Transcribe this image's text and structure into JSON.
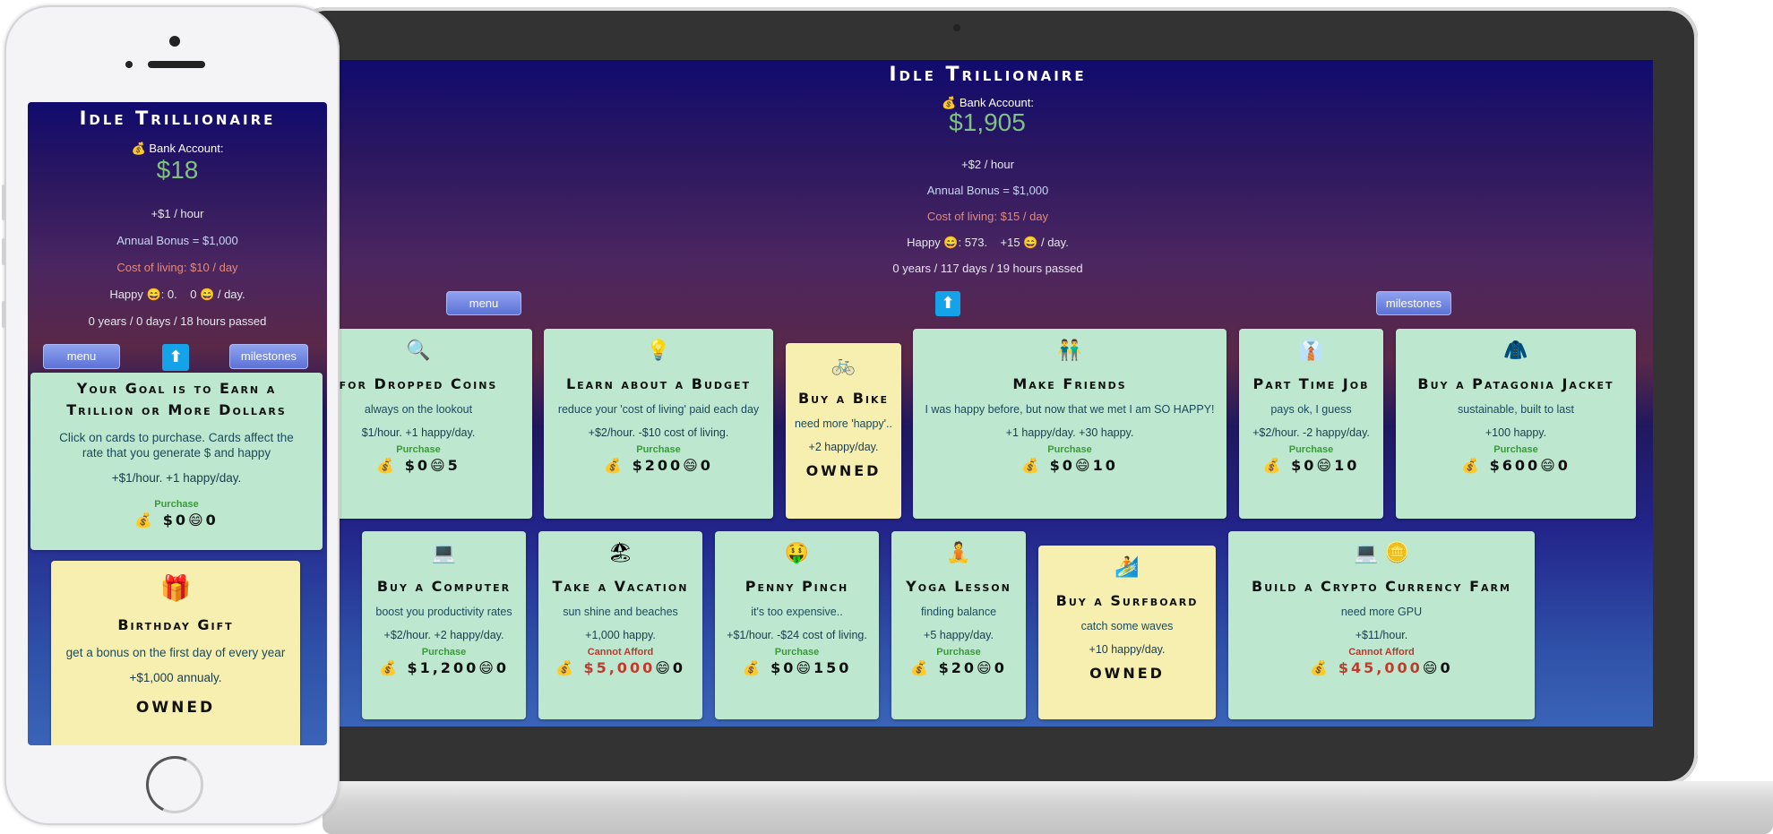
{
  "laptop": {
    "title": "Idle Trillionaire",
    "bank_label": "💰 Bank Account:",
    "bank_value": "$1,905",
    "rate": "+$2 / hour",
    "annual": "Annual Bonus = $1,000",
    "cost_of_living": "Cost of living: $15 / day",
    "happy": "Happy 😄: 573.    +15 😄 / day.",
    "time": "0 years / 117 days / 19 hours passed",
    "menu_label": "menu",
    "up_label": "⬆",
    "milestones_label": "milestones",
    "cards": [
      {
        "emoji": "🔍",
        "name": "for Dropped Coins",
        "desc": "always on the lookout",
        "effect": "$1/hour. +1 happy/day.",
        "status": "Purchase",
        "price": "💰 $0😄5",
        "owned": false
      },
      {
        "emoji": "💡",
        "name": "Learn about a Budget",
        "desc": "reduce your 'cost of living' paid each day",
        "effect": "+$2/hour. -$10 cost of living.",
        "status": "Purchase",
        "price": "💰 $200😄0",
        "owned": false
      },
      {
        "emoji": "🚲",
        "name": "Buy a Bike",
        "desc": "need more 'happy'..",
        "effect": "+2 happy/day.",
        "owned_label": "OWNED",
        "owned": true
      },
      {
        "emoji": "👬",
        "name": "Make Friends",
        "desc": "I was happy before, but now that we met I am SO HAPPY!",
        "effect": "+1 happy/day. +30 happy.",
        "status": "Purchase",
        "price": "💰 $0😄10",
        "owned": false
      },
      {
        "emoji": "👔",
        "name": "Part Time Job",
        "desc": "pays ok, I guess",
        "effect": "+$2/hour. -2 happy/day.",
        "status": "Purchase",
        "price": "💰 $0😄10",
        "owned": false
      },
      {
        "emoji": "🧥",
        "name": "Buy a Patagonia Jacket",
        "desc": "sustainable, built to last",
        "effect": "+100 happy.",
        "status": "Purchase",
        "price": "💰 $600😄0",
        "owned": false
      },
      {
        "emoji": "💻",
        "name": "Buy a Computer",
        "desc": "boost you productivity rates",
        "effect": "+$2/hour. +2 happy/day.",
        "status": "Purchase",
        "price": "💰 $1,200😄0",
        "owned": false
      },
      {
        "emoji": "🏖",
        "name": "Take a Vacation",
        "desc": "sun shine and beaches",
        "effect": "+1,000 happy.",
        "status": "Cannot Afford",
        "price_red": "💰 $5,000",
        "price_rest": "😄0",
        "owned": false
      },
      {
        "emoji": "🤑",
        "name": "Penny Pinch",
        "desc": "it's too expensive..",
        "effect": "+$1/hour. -$24 cost of living.",
        "status": "Purchase",
        "price": "💰 $0😄150",
        "owned": false
      },
      {
        "emoji": "🧘",
        "name": "Yoga Lesson",
        "desc": "finding balance",
        "effect": "+5 happy/day.",
        "status": "Purchase",
        "price": "💰 $20😄0",
        "owned": false
      },
      {
        "emoji": "🏄",
        "name": "Buy a Surfboard",
        "desc": "catch some waves",
        "effect": "+10 happy/day.",
        "owned_label": "OWNED",
        "owned": true
      },
      {
        "emoji": "💻 🪙",
        "name": "Build a Crypto Currency Farm",
        "desc": "need more GPU",
        "effect": "+$11/hour.",
        "status": "Cannot Afford",
        "price_red": "💰 $45,000",
        "price_rest": "😄0",
        "owned": false
      }
    ]
  },
  "phone": {
    "title": "Idle Trillionaire",
    "bank_label": "💰 Bank Account:",
    "bank_value": "$18",
    "rate": "+$1 / hour",
    "annual": "Annual Bonus = $1,000",
    "cost_of_living": "Cost of living: $10 / day",
    "happy": "Happy 😄: 0.    0 😄 / day.",
    "time": "0 years / 0 days / 18 hours passed",
    "menu_label": "menu",
    "up_label": "⬆",
    "milestones_label": "milestones",
    "goal": {
      "name": "Your Goal is to Earn a Trillion or More Dollars",
      "desc": "Click on cards to purchase. Cards affect the rate that you generate $ and happy",
      "effect": "+$1/hour. +1 happy/day.",
      "status": "Purchase",
      "price": "💰 $0😄0"
    },
    "gift": {
      "emoji": "🎁",
      "name": "Birthday Gift",
      "desc": "get a bonus on the first day of every year",
      "effect": "+$1,000 annualy.",
      "owned_label": "OWNED"
    }
  },
  "colors": {
    "card_green": "#bde8cf",
    "card_owned": "#f7efaf",
    "bank_green": "#7ec27e",
    "cost_red": "#e28a78",
    "button_blue": "#5c72d6",
    "up_blue": "#14a3e8"
  }
}
